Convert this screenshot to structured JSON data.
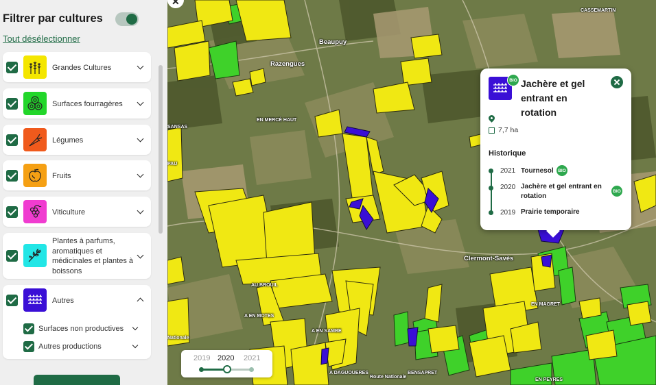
{
  "sidebar": {
    "title": "Filtrer par cultures",
    "deselect_all": "Tout désélectionner",
    "filter_enabled": true,
    "categories": [
      {
        "label": "Grandes Cultures",
        "checked": true,
        "icon": "wheat-icon",
        "color": "#f4e600",
        "expanded": false
      },
      {
        "label": "Surfaces fourragères",
        "checked": true,
        "icon": "hay-bales-icon",
        "color": "#22d62a",
        "expanded": false
      },
      {
        "label": "Légumes",
        "checked": true,
        "icon": "carrot-icon",
        "color": "#f05a1c",
        "expanded": false
      },
      {
        "label": "Fruits",
        "checked": true,
        "icon": "apple-icon",
        "color": "#f5a014",
        "expanded": false
      },
      {
        "label": "Viticulture",
        "checked": true,
        "icon": "grapes-icon",
        "color": "#f03cd0",
        "expanded": false
      },
      {
        "label": "Plantes à parfums, aromatiques et médicinales et plantes à boissons",
        "checked": true,
        "icon": "herb-icon",
        "color": "#22e6e6",
        "expanded": false
      },
      {
        "label": "Autres",
        "checked": true,
        "icon": "crop-rows-icon",
        "color": "#3a0fd6",
        "expanded": true
      }
    ],
    "sub_items": [
      {
        "label": "Surfaces non productives",
        "checked": true
      },
      {
        "label": "Autres productions",
        "checked": true
      }
    ]
  },
  "map": {
    "places": [
      "Beaupuy",
      "Razengues",
      "EN MERCÉ HAUT",
      "SANSAS",
      "AU BROUIL",
      "A EN MOTES",
      "A EN SAMBE",
      "A DAGUOUERES",
      "Clermont-Savès",
      "EN MAGRET",
      "Route Nationale",
      "BENSAPRET",
      "CASSEMARTIN",
      "Nationale",
      "EN PEYRES",
      "PAU"
    ],
    "popup": {
      "title": "Jachère et gel entrant en rotation",
      "bio_badge": "BIO",
      "area": "7,7 ha",
      "history_title": "Historique",
      "history": [
        {
          "year": "2021",
          "crop": "Tournesol",
          "bio": "BIO"
        },
        {
          "year": "2020",
          "crop": "Jachère et gel entrant en rotation",
          "bio": "BIO"
        },
        {
          "year": "2019",
          "crop": "Prairie temporaire",
          "bio": ""
        }
      ]
    },
    "years": {
      "items": [
        "2019",
        "2020",
        "2021"
      ],
      "selected": "2020"
    }
  },
  "colors": {
    "brand_green": "#1f6b45",
    "field_yellow": "#f0e813",
    "field_green": "#3fd12a",
    "field_blue": "#3a0fd6"
  }
}
